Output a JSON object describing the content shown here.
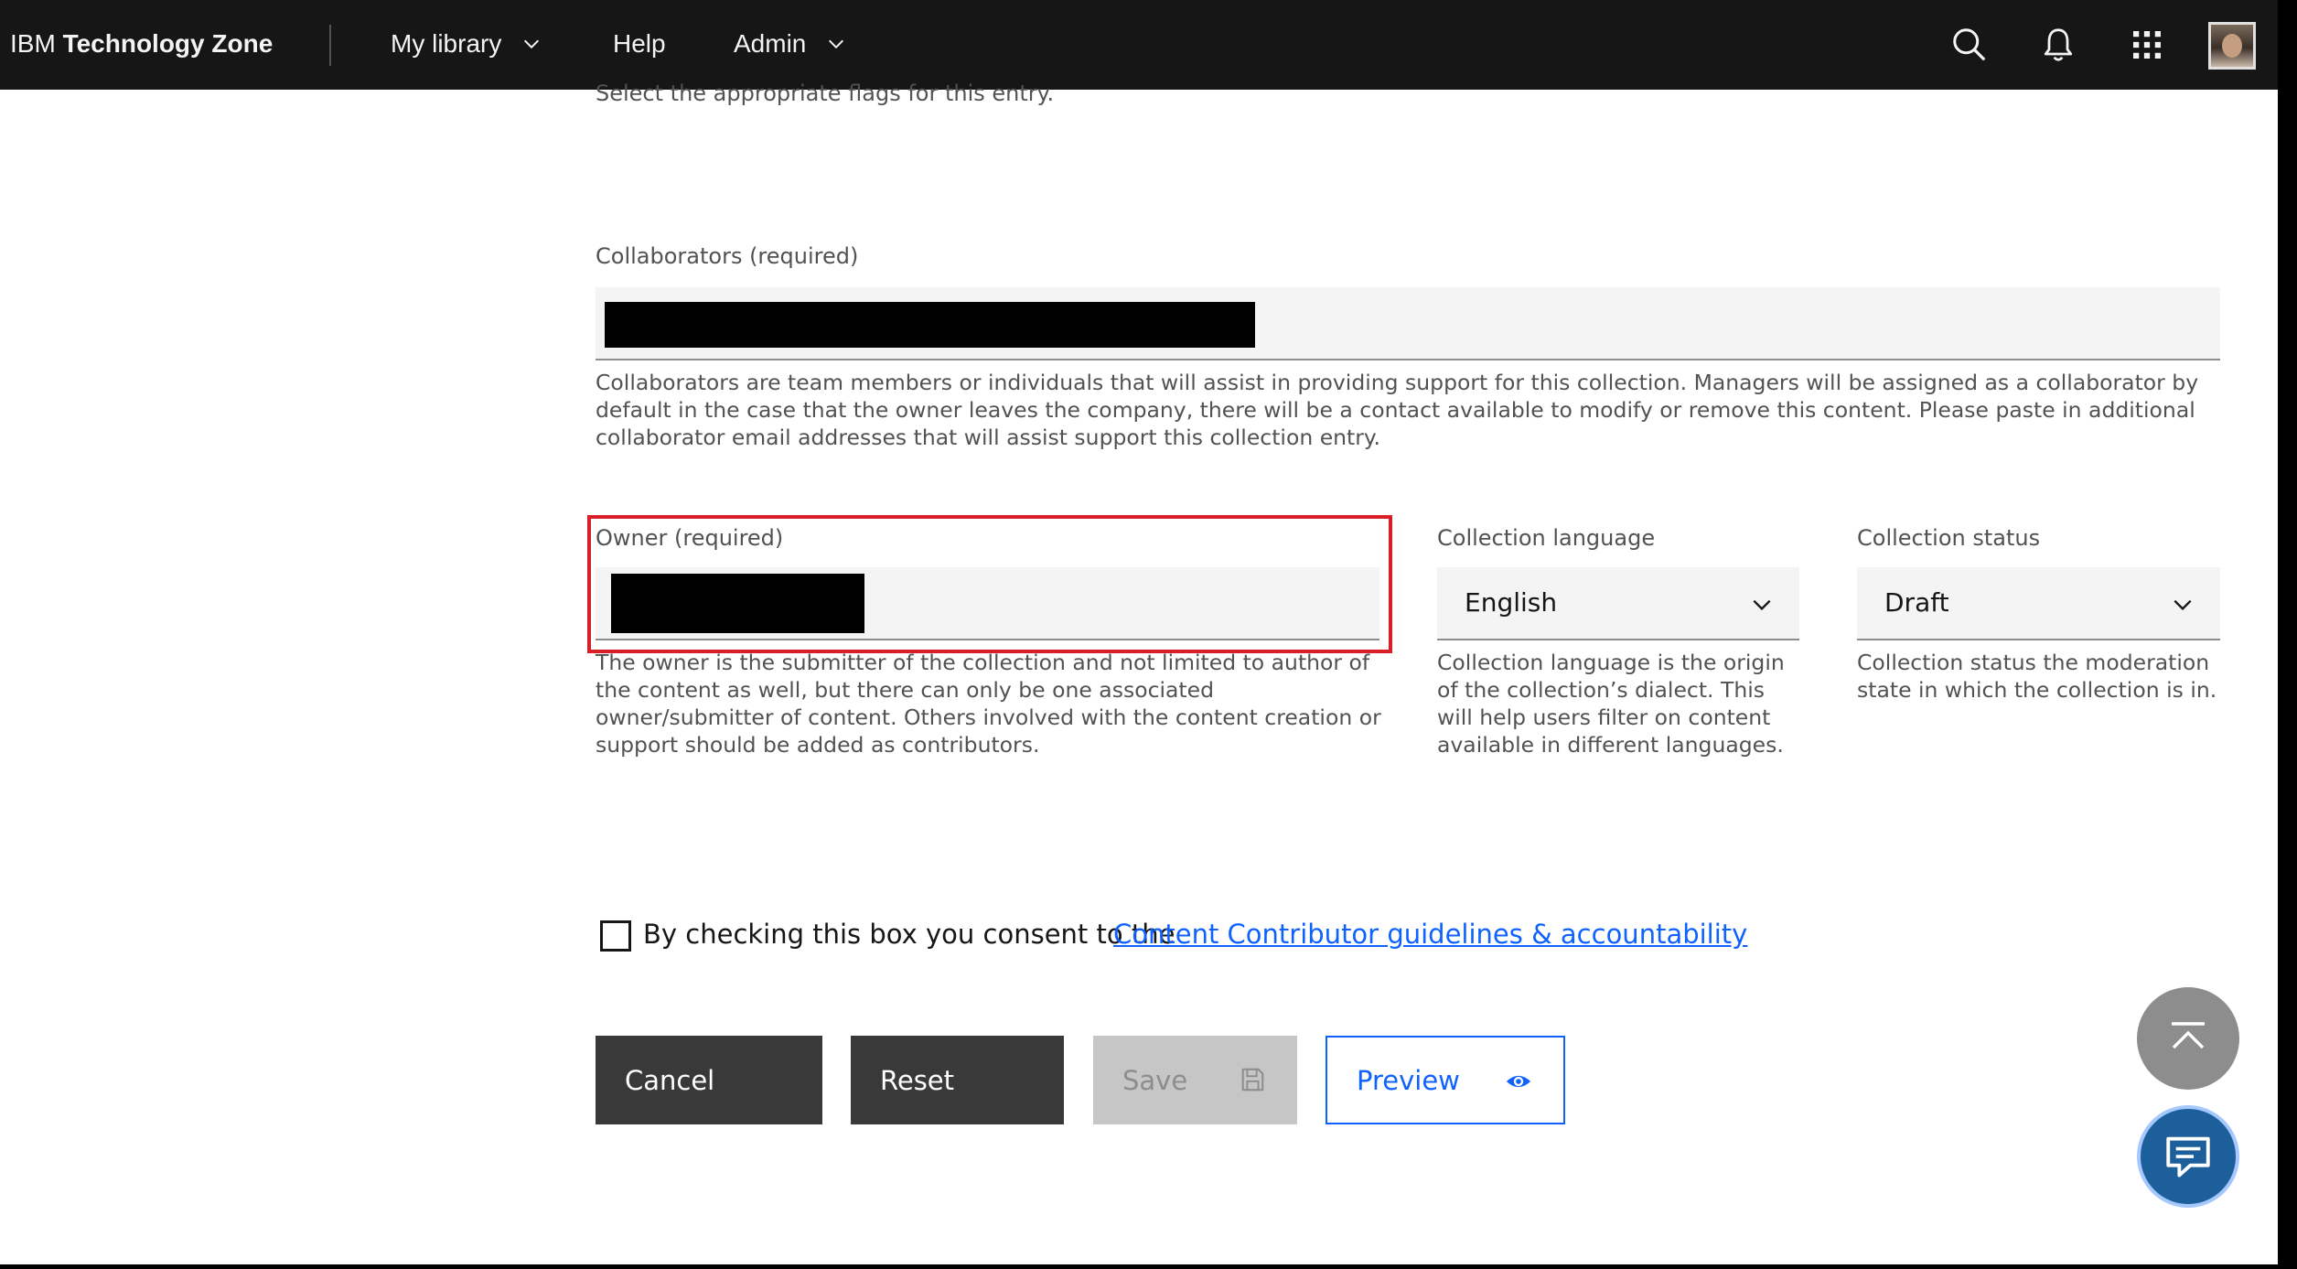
{
  "header": {
    "brand_prefix": "IBM",
    "brand_name": "Technology Zone",
    "nav": [
      {
        "label": "My library"
      },
      {
        "label": "Help"
      },
      {
        "label": "Admin"
      }
    ],
    "icons": [
      "search-icon",
      "notification-icon",
      "app-switcher-icon",
      "user-avatar"
    ]
  },
  "form": {
    "flags_helper": "Select the appropriate flags for this entry.",
    "collaborators": {
      "label": "Collaborators (required)",
      "helper": "Collaborators are team members or individuals that will assist in providing support for this collection. Managers will be assigned as a collaborator by default in the case that the owner leaves the company, there will be a contact available to modify or remove this content. Please paste in additional collaborator email addresses that will assist support this collection entry."
    },
    "owner": {
      "label": "Owner (required)",
      "helper": "The owner is the submitter of the collection and not limited to author of the content as well, but there can only be one associated owner/submitter of content. Others involved with the content creation or support should be added as contributors."
    },
    "language": {
      "label": "Collection language",
      "value": "English",
      "helper": "Collection language is the origin of the collection’s dialect. This will help users filter on content available in different languages."
    },
    "status": {
      "label": "Collection status",
      "value": "Draft",
      "helper": "Collection status the moderation state in which the collection is in."
    },
    "consent": {
      "text": "By checking this box you consent to the",
      "link": "Content Contributor guidelines & accountability",
      "checked": false
    }
  },
  "actions": {
    "cancel": "Cancel",
    "reset": "Reset",
    "save": "Save",
    "preview": "Preview"
  },
  "colors": {
    "header_bg": "#161616",
    "primary": "#0f62fe",
    "highlight": "#da1e28",
    "chat": "#1c5f9a"
  }
}
